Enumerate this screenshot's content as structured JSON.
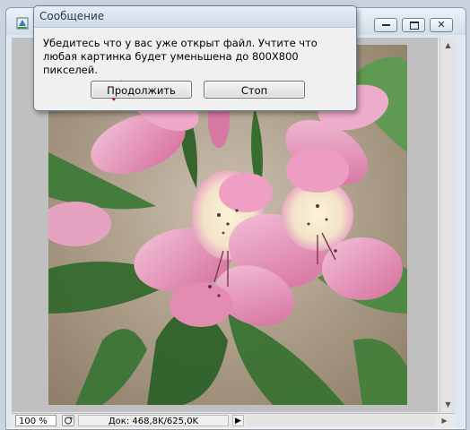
{
  "document_window": {
    "buttons": {
      "minimize_icon": "minimize-icon",
      "maximize_icon": "maximize-icon",
      "close_icon": "close-icon",
      "close_glyph": "✕"
    },
    "statusbar": {
      "zoom": "100 %",
      "doc_info": "Док: 468,8K/625,0K",
      "arrow_glyph": "▶"
    },
    "scroll": {
      "up_glyph": "▲",
      "down_glyph": "▼",
      "right_glyph": "▶"
    }
  },
  "dialog": {
    "title": "Сообщение",
    "message": "Убедитесь что у вас уже открыт файл. Учтите что любая картинка будет уменьшена до 800Х800 пикселей.",
    "continue_label": "Продолжить",
    "stop_label": "Стоп",
    "annotation_color": "#d40000"
  },
  "colors": {
    "annotation": "#d40000",
    "petal_pink": "#e58fb4",
    "leaf_green": "#3f7a38",
    "background_beige": "#b6a58e"
  }
}
